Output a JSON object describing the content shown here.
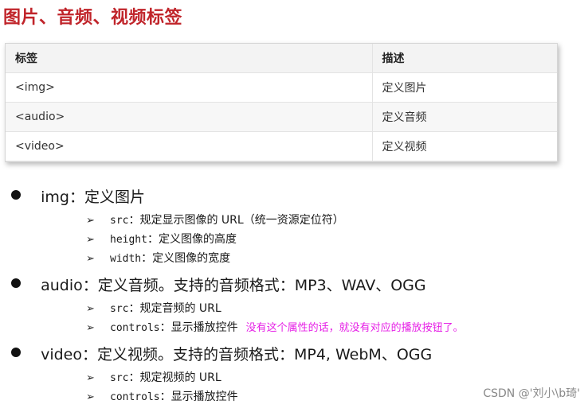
{
  "title": "图片、音频、视频标签",
  "table": {
    "headers": [
      "标签",
      "描述"
    ],
    "rows": [
      [
        "<img>",
        "定义图片"
      ],
      [
        "<audio>",
        "定义音频"
      ],
      [
        "<video>",
        "定义视频"
      ]
    ]
  },
  "sections": [
    {
      "heading": "img：定义图片",
      "items": [
        {
          "code": "src",
          "text": "：规定显示图像的 URL（统一资源定位符）"
        },
        {
          "code": "height",
          "text": "：定义图像的高度"
        },
        {
          "code": "width",
          "text": "：定义图像的宽度"
        }
      ]
    },
    {
      "heading": "audio：定义音频。支持的音频格式：MP3、WAV、OGG",
      "items": [
        {
          "code": "src",
          "text": "：规定音频的 URL"
        },
        {
          "code": "controls",
          "text": "：显示播放控件",
          "note": "没有这个属性的话，就没有对应的播放按钮了。"
        }
      ]
    },
    {
      "heading": "video：定义视频。支持的音频格式：MP4, WebM、OGG",
      "items": [
        {
          "code": "src",
          "text": "：规定视频的 URL"
        },
        {
          "code": "controls",
          "text": "：显示播放控件"
        }
      ]
    }
  ],
  "arrow_glyph": "➢",
  "watermark": "CSDN @'刘小\\b琦'"
}
